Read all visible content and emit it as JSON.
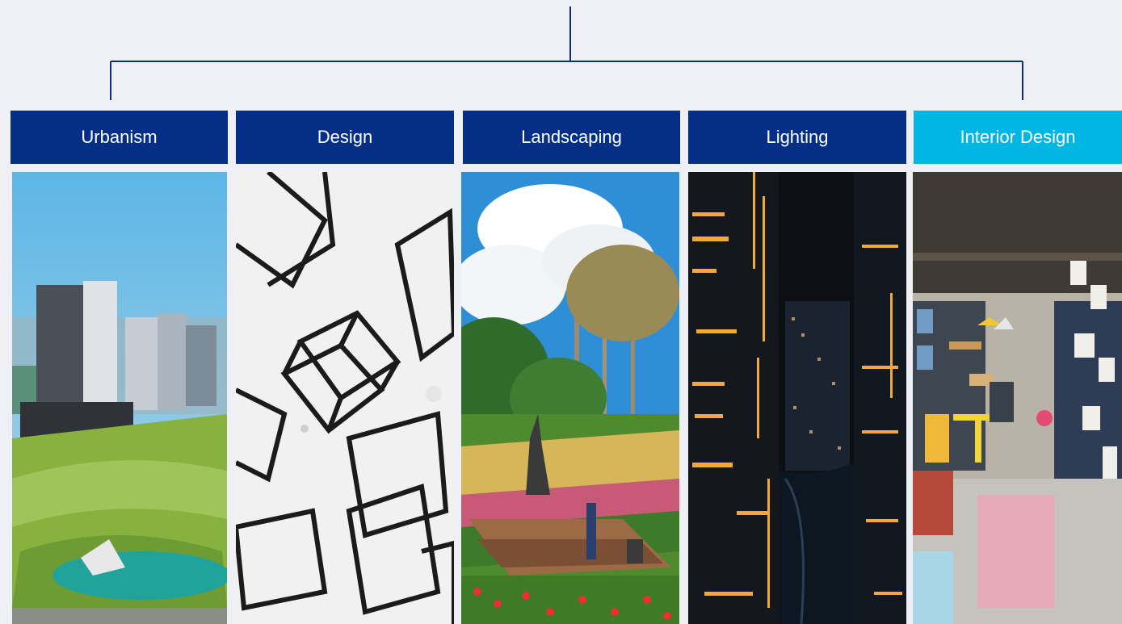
{
  "tree": {
    "categories": [
      {
        "label": "Urbanism",
        "image": "city-park-aerial-photo"
      },
      {
        "label": "Design",
        "image": "wire-cube-pendant-lights-photo"
      },
      {
        "label": "Landscaping",
        "image": "flower-garden-park-photo"
      },
      {
        "label": "Lighting",
        "image": "night-skyscrapers-photo"
      },
      {
        "label": "Interior Design",
        "image": "office-lounge-interior-photo"
      }
    ],
    "active_index": 4
  },
  "colors": {
    "background": "#efeff6",
    "tab": "#052f87",
    "tab_active": "#00b6e3",
    "connector": "#0a2f7d"
  }
}
